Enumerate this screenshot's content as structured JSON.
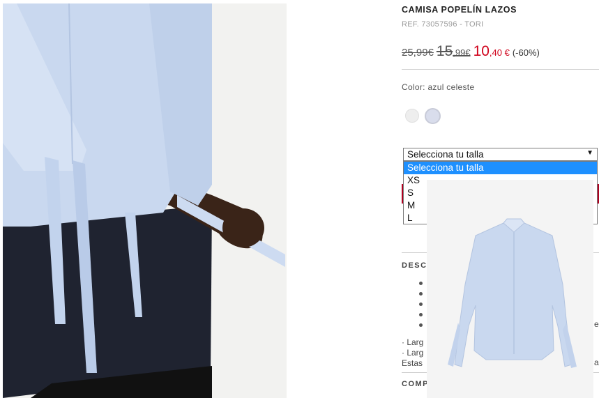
{
  "product": {
    "title": "CAMISA POPELÍN LAZOS",
    "ref": "REF. 73057596 - TORI"
  },
  "prices": {
    "original": "25,99€",
    "previous_int": "15",
    "previous_dec": ",99€",
    "current_int": "10",
    "current_dec": ",40 €",
    "discount": "(-60%)"
  },
  "color": {
    "label": "Color: azul celeste",
    "swatches": [
      "#eeeeee",
      "#d9ddec"
    ]
  },
  "size_select": {
    "value": "Selecciona tu talla",
    "options": [
      "Selecciona tu talla",
      "XS",
      "S",
      "M",
      "L"
    ],
    "highlighted_index": 0
  },
  "description": {
    "heading_visible": "DESC",
    "lines": [
      "· Larg",
      "· Larg",
      "Estas"
    ],
    "cut_right_1": "e",
    "cut_right_2": "a"
  },
  "composition": {
    "heading_visible": "COMP"
  },
  "colors": {
    "price_red": "#d0021b",
    "select_highlight": "#1e90ff",
    "shirt_blue": "#c9d8ef"
  }
}
